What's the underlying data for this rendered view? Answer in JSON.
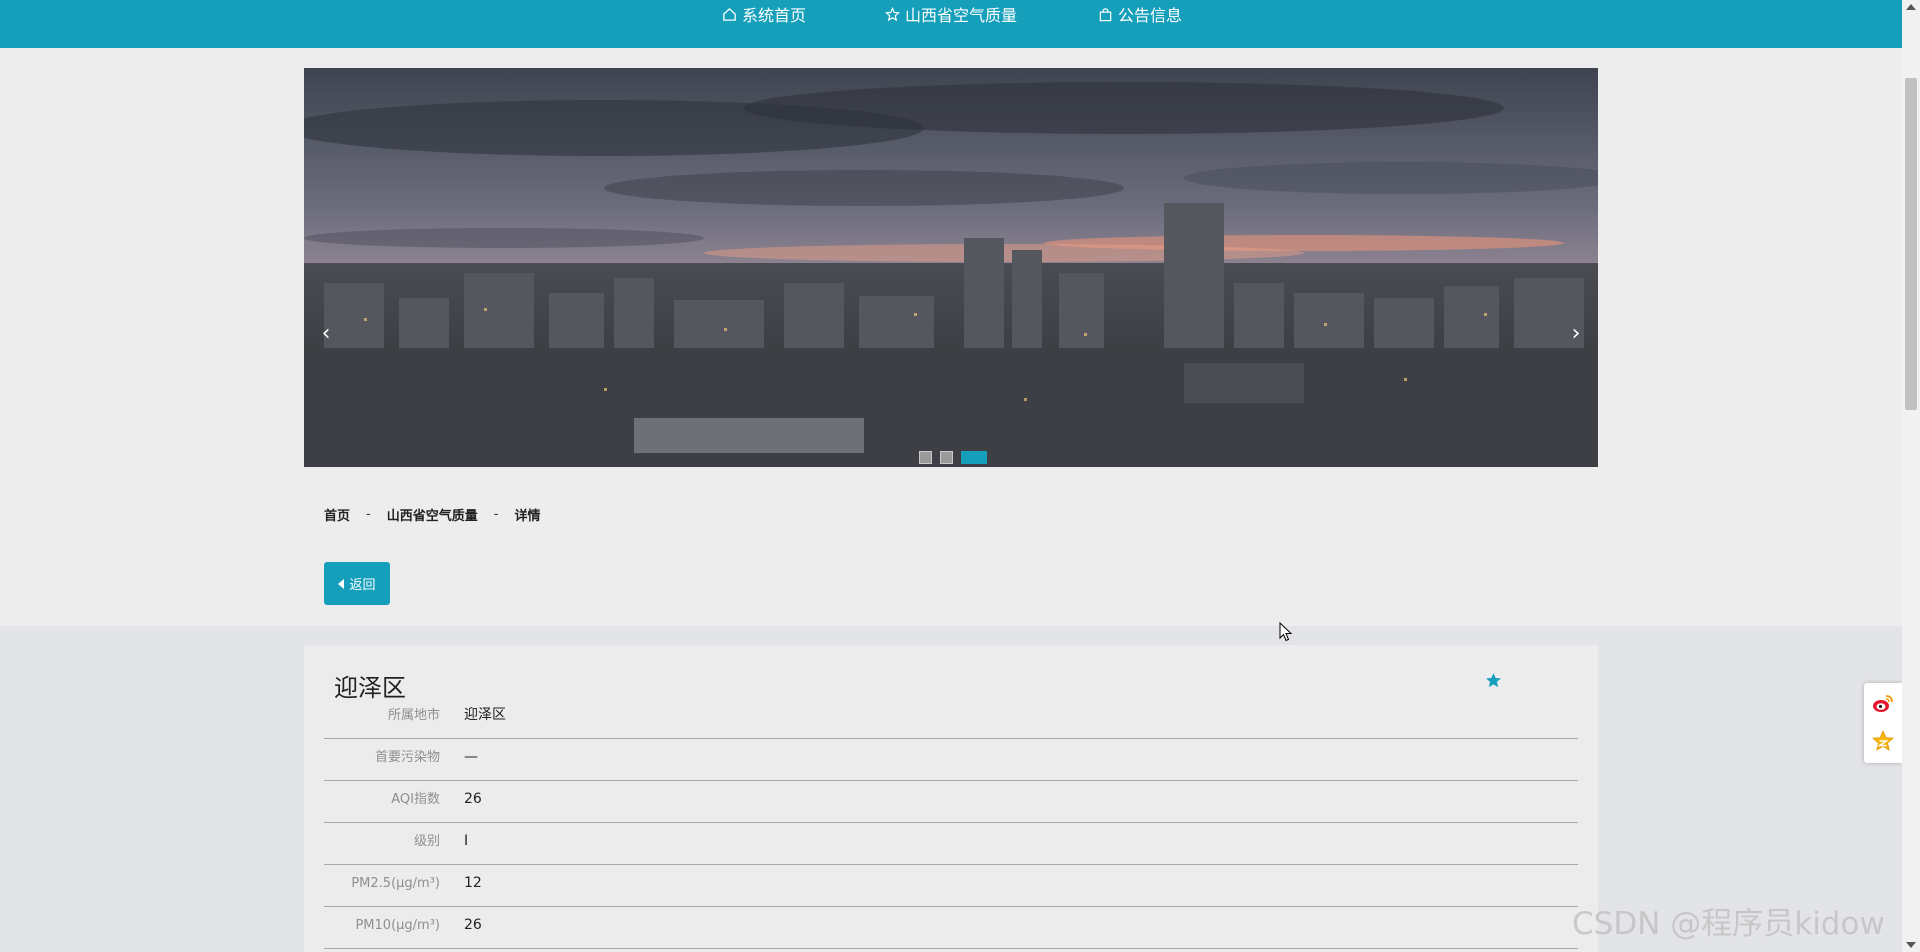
{
  "nav": {
    "home": {
      "label": "系统首页",
      "icon": "home-icon"
    },
    "air_quality": {
      "label": "山西省空气质量",
      "icon": "star-outline-icon"
    },
    "notice": {
      "label": "公告信息",
      "icon": "bag-icon"
    }
  },
  "carousel": {
    "prev_glyph": "‹",
    "next_glyph": "›",
    "slide_count": 3,
    "active_slide": 3
  },
  "breadcrumb": {
    "home": "首页",
    "section": "山西省空气质量",
    "current": "详情",
    "separator": "-"
  },
  "back_button": {
    "label": "返回"
  },
  "detail": {
    "title": "迎泽区",
    "rows": [
      {
        "label": "所属地市",
        "value": "迎泽区"
      },
      {
        "label": "首要污染物",
        "value": "—"
      },
      {
        "label": "AQI指数",
        "value": "26"
      },
      {
        "label": "级别",
        "value": "I"
      },
      {
        "label": "PM2.5(μg/m³)",
        "value": "12"
      },
      {
        "label": "PM10(μg/m³)",
        "value": "26"
      }
    ]
  },
  "watermark": "CSDN @程序员kidow",
  "colors": {
    "accent": "#159fbb",
    "upper_background": "#ededed",
    "lower_background": "#e3e4e8"
  }
}
